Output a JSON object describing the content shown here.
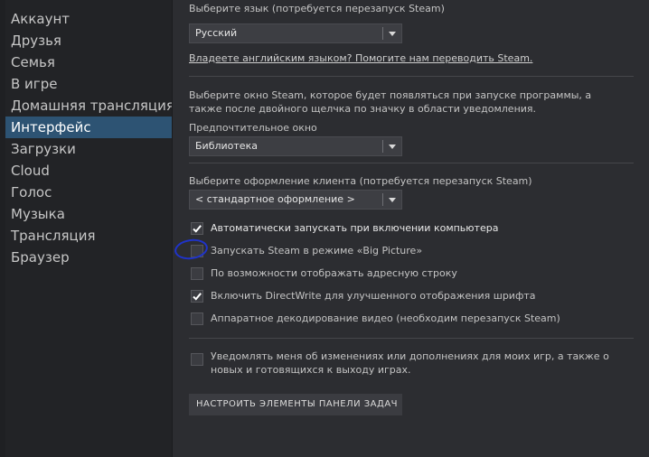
{
  "sidebar": {
    "items": [
      {
        "label": "Аккаунт"
      },
      {
        "label": "Друзья"
      },
      {
        "label": "Семья"
      },
      {
        "label": "В игре"
      },
      {
        "label": "Домашняя трансляция"
      },
      {
        "label": "Интерфейс"
      },
      {
        "label": "Загрузки"
      },
      {
        "label": "Cloud"
      },
      {
        "label": "Голос"
      },
      {
        "label": "Музыка"
      },
      {
        "label": "Трансляция"
      },
      {
        "label": "Браузер"
      }
    ],
    "active_index": 5
  },
  "language": {
    "label": "Выберите язык (потребуется перезапуск Steam)",
    "selected": "Русский",
    "help_link": "Владеете английским языком? Помогите нам переводить Steam."
  },
  "window": {
    "description_line1": "Выберите окно Steam, которое будет появляться при запуске программы, а",
    "description_line2": "также после двойного щелчка по значку в области уведомления.",
    "label": "Предпочтительное окно",
    "selected": "Библиотека"
  },
  "skin": {
    "label": "Выберите оформление клиента (потребуется перезапуск Steam)",
    "selected": "< стандартное оформление >"
  },
  "options": [
    {
      "label": "Автоматически запускать при включении компьютера",
      "checked": true
    },
    {
      "label": "Запускать Steam в режиме «Big Picture»",
      "checked": false
    },
    {
      "label": "По возможности отображать адресную строку",
      "checked": false
    },
    {
      "label": "Включить DirectWrite для улучшенного отображения шрифта",
      "checked": true
    },
    {
      "label": "Аппаратное декодирование видео (необходим перезапуск Steam)",
      "checked": false
    }
  ],
  "notify": {
    "line1": "Уведомлять меня об изменениях или дополнениях для моих игр, а также о",
    "line2": "новых и готовящихся к выходу играх.",
    "checked": false
  },
  "taskbar_button": {
    "label": "НАСТРОИТЬ ЭЛЕМЕНТЫ ПАНЕЛИ ЗАДАЧ"
  },
  "colors": {
    "active_item": "#2d5373",
    "annotation_circle": "#1f33c9"
  }
}
